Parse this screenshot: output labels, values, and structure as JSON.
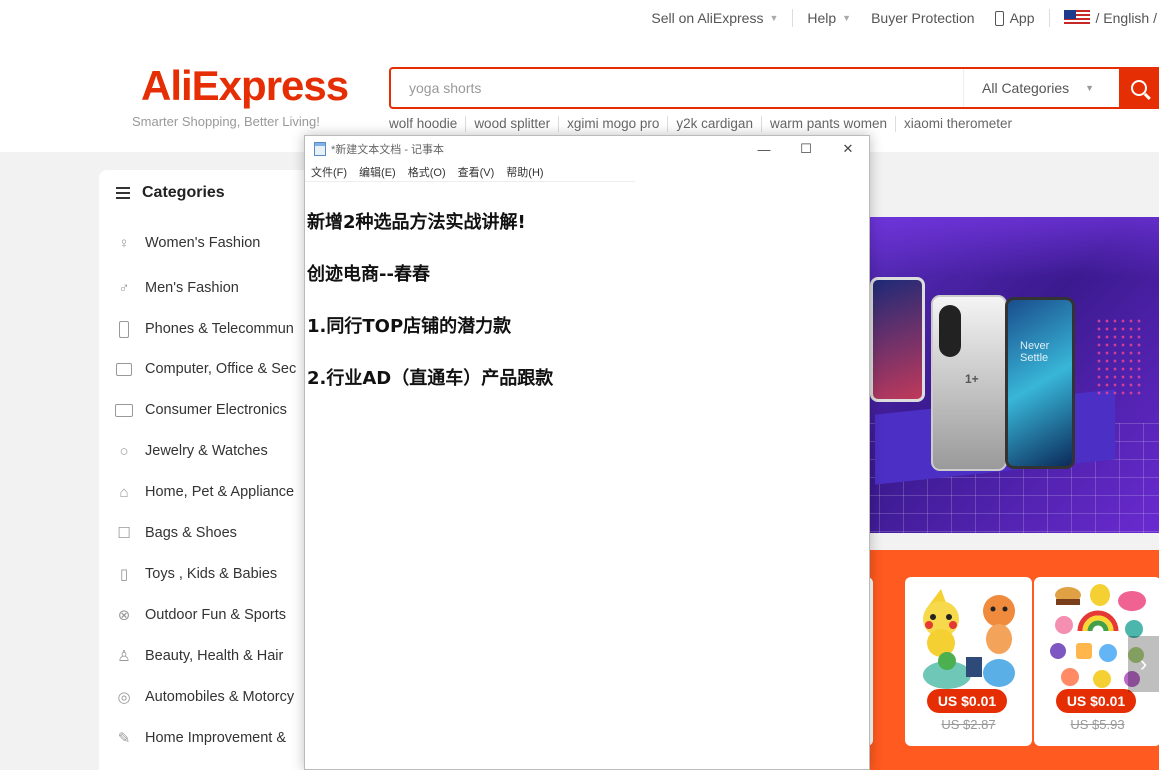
{
  "topbar": {
    "sell": "Sell on AliExpress",
    "help": "Help",
    "buyer_protection": "Buyer Protection",
    "app": "App",
    "language": "/ English /"
  },
  "header": {
    "logo": "AliExpress",
    "slogan": "Smarter Shopping, Better Living!",
    "search_value": "yoga shorts",
    "category_select": "All Categories",
    "hot_searches": [
      "wolf hoodie",
      "wood splitter",
      "xgimi mogo pro",
      "y2k cardigan",
      "warm pants women",
      "xiaomi therometer"
    ]
  },
  "categories": {
    "title": "Categories",
    "items": [
      {
        "label": "Women's Fashion",
        "icon": "dress-icon"
      },
      {
        "label": "Men's Fashion",
        "icon": "shirt-icon"
      },
      {
        "label": "Phones & Telecommun",
        "icon": "phone-icon"
      },
      {
        "label": "Computer, Office & Sec",
        "icon": "laptop-icon"
      },
      {
        "label": "Consumer Electronics",
        "icon": "camera-icon"
      },
      {
        "label": "Jewelry & Watches",
        "icon": "ring-icon"
      },
      {
        "label": "Home, Pet & Appliance",
        "icon": "sofa-icon"
      },
      {
        "label": "Bags & Shoes",
        "icon": "bag-icon"
      },
      {
        "label": "Toys , Kids & Babies",
        "icon": "bottle-icon"
      },
      {
        "label": "Outdoor Fun & Sports",
        "icon": "ball-icon"
      },
      {
        "label": "Beauty, Health & Hair",
        "icon": "lipstick-icon"
      },
      {
        "label": "Automobiles & Motorcy",
        "icon": "wheel-icon"
      },
      {
        "label": "Home Improvement &",
        "icon": "tool-icon"
      }
    ]
  },
  "banner": {
    "phone_logo": "1+",
    "phone_slogan_line1": "Never",
    "phone_slogan_line2": "Settle"
  },
  "deals": [
    {
      "price": "US $0.01",
      "old_price": "US $2.87"
    },
    {
      "price": "US $0.01",
      "old_price": "US $5.93"
    }
  ],
  "notepad": {
    "title": "*新建文本文档 - 记事本",
    "menu": [
      "文件(F)",
      "编辑(E)",
      "格式(O)",
      "查看(V)",
      "帮助(H)"
    ],
    "lines": [
      "新增2种选品方法实战讲解!",
      "创迹电商--春春",
      "1.同行TOP店铺的潜力款",
      "2.行业AD（直通车）产品跟款"
    ]
  },
  "colors": {
    "brand": "#e62e04",
    "deals_bg": "#ff5a1f"
  }
}
